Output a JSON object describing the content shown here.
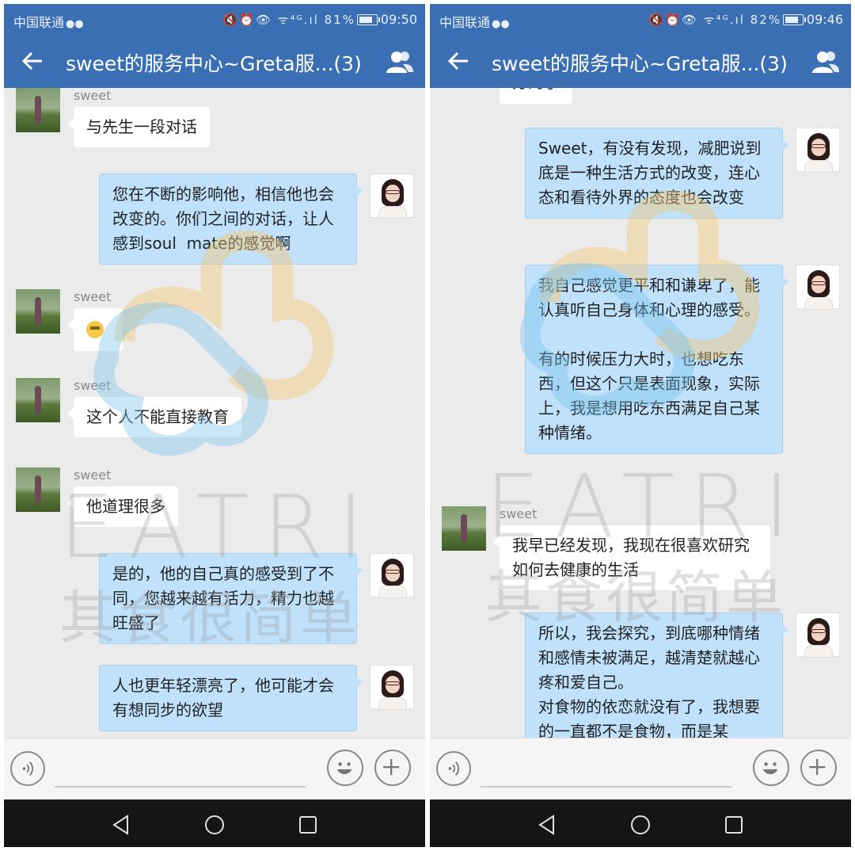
{
  "colors": {
    "appbar": "#3b6fb4",
    "sent_bubble": "#bfe1fb",
    "received_bubble": "#ffffff",
    "chat_bg": "#ebebeb",
    "nav_bg": "#151515"
  },
  "icons": [
    "back-arrow-icon",
    "group-members-icon",
    "voice-icon",
    "emoji-icon",
    "plus-icon",
    "nav-back-icon",
    "nav-home-icon",
    "nav-recent-icon",
    "wechat-icon"
  ],
  "watermark": {
    "logo": "EATRI",
    "slogan": "其食很简单"
  },
  "left": {
    "status": {
      "carrier": "中国联通",
      "battery": "81%",
      "battery_level": 0.81,
      "time": "09:50"
    },
    "header": {
      "title": "sweet的服务中心~Greta服...(3)"
    },
    "messages": [
      {
        "from": "other",
        "sender": "sweet",
        "text": "与先生一段对话"
      },
      {
        "from": "me",
        "text": "您在不断的影响他，相信他也会改变的。你们之间的对话，让人感到soul  mate的感觉啊"
      },
      {
        "from": "other",
        "sender": "sweet",
        "text": "",
        "emoji": "grin-emoji"
      },
      {
        "from": "other",
        "sender": "sweet",
        "text": "这个人不能直接教育"
      },
      {
        "from": "other",
        "sender": "sweet",
        "text": "他道理很多"
      },
      {
        "from": "me",
        "text": "是的，他的自己真的感受到了不同，您越来越有活力，精力也越旺盛了"
      },
      {
        "from": "me",
        "text": "人也更年轻漂亮了，他可能才会有想同步的欲望"
      }
    ]
  },
  "right": {
    "status": {
      "carrier": "中国联通",
      "battery": "82%",
      "battery_level": 0.82,
      "time": "09:46"
    },
    "header": {
      "title": "sweet的服务中心~Greta服...(3)"
    },
    "messages": [
      {
        "from": "other",
        "sender": "",
        "text": "方的了"
      },
      {
        "from": "me",
        "text": "Sweet，有没有发现，减肥说到底是一种生活方式的改变，连心态和看待外界的态度也会改变"
      },
      {
        "from": "me",
        "text": "我自己感觉更平和和谦卑了，能认真听自己身体和心理的感受。\n\n有的时候压力大时，也想吃东西，但这个只是表面现象，实际上，我是想用吃东西满足自己某种情绪。"
      },
      {
        "from": "other",
        "sender": "sweet",
        "text": "我早已经发现，我现在很喜欢研究如何去健康的生活"
      },
      {
        "from": "me",
        "text": "所以，我会探究，到底哪种情绪和感情未被满足，越清楚就越心疼和爱自己。\n对食物的依恋就没有了，我想要的一直都不是食物，而是某"
      }
    ]
  }
}
